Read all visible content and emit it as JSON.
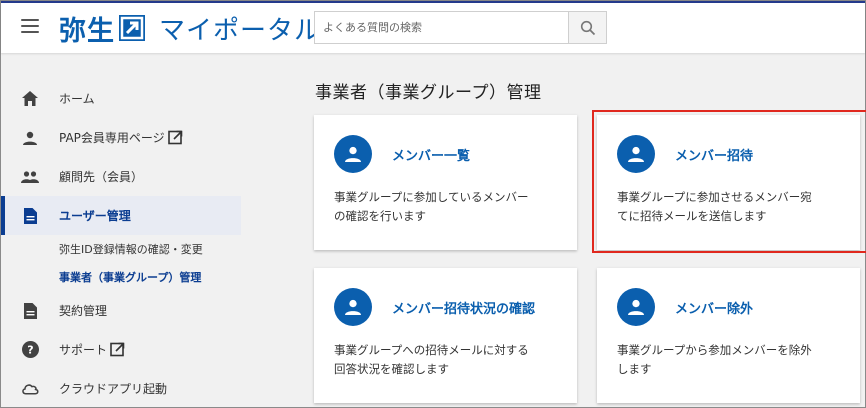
{
  "header": {
    "brand_name": "弥生",
    "portal_name": "マイポータル",
    "search_placeholder": "よくある質問の検索"
  },
  "sidebar": {
    "items": [
      {
        "label": "ホーム",
        "icon": "home-icon"
      },
      {
        "label": "PAP会員専用ページ",
        "icon": "person-icon",
        "external": true
      },
      {
        "label": "顧問先（会員）",
        "icon": "group-icon"
      },
      {
        "label": "ユーザー管理",
        "icon": "document-icon",
        "active": true
      },
      {
        "label": "契約管理",
        "icon": "document-icon"
      },
      {
        "label": "サポート",
        "icon": "help-icon",
        "external": true
      },
      {
        "label": "クラウドアプリ起動",
        "icon": "cloud-icon"
      }
    ],
    "sub_items": [
      {
        "label": "弥生ID登録情報の確認・変更"
      },
      {
        "label": "事業者（事業グループ）管理",
        "current": true
      }
    ]
  },
  "main": {
    "title": "事業者（事業グループ）管理",
    "cards": [
      {
        "title": "メンバー一覧",
        "desc_line1": "事業グループに参加しているメンバー",
        "desc_line2": "の確認を行います"
      },
      {
        "title": "メンバー招待",
        "desc_line1": "事業グループに参加させるメンバー宛",
        "desc_line2": "てに招待メールを送信します"
      },
      {
        "title": "メンバー招待状況の確認",
        "desc_line1": "事業グループへの招待メールに対する",
        "desc_line2": "回答状況を確認します"
      },
      {
        "title": "メンバー除外",
        "desc_line1": "事業グループから参加メンバーを除外",
        "desc_line2": "します"
      }
    ]
  },
  "colors": {
    "brand": "#0b5fae",
    "active_nav": "#0b3d91",
    "highlight": "#e0281e"
  }
}
